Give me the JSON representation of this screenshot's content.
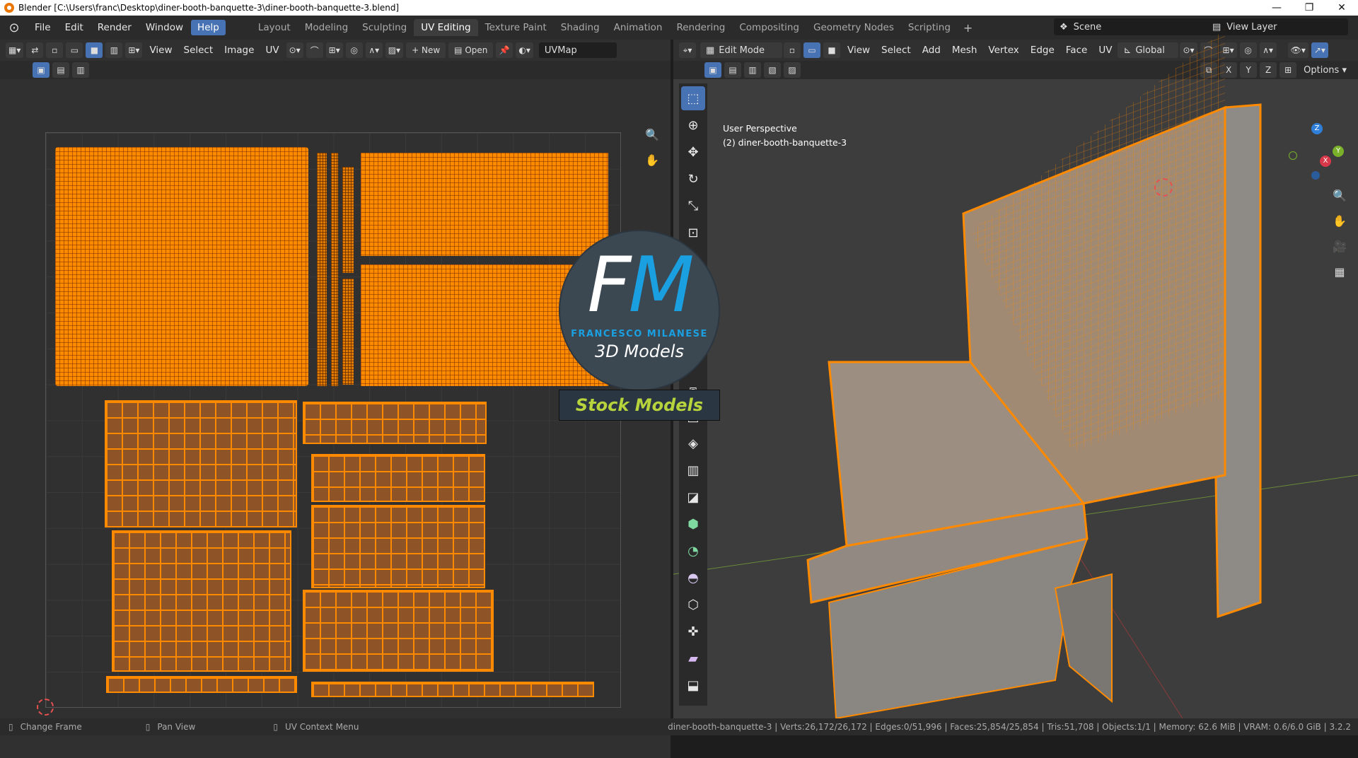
{
  "window": {
    "title": "Blender [C:\\Users\\franc\\Desktop\\diner-booth-banquette-3\\diner-booth-banquette-3.blend]",
    "minimize": "—",
    "maximize": "❐",
    "close": "✕"
  },
  "menu": {
    "items": [
      "File",
      "Edit",
      "Render",
      "Window",
      "Help"
    ],
    "active": "Help"
  },
  "workspaces": {
    "tabs": [
      "Layout",
      "Modeling",
      "Sculpting",
      "UV Editing",
      "Texture Paint",
      "Shading",
      "Animation",
      "Rendering",
      "Compositing",
      "Geometry Nodes",
      "Scripting"
    ],
    "active": "UV Editing",
    "add": "+"
  },
  "scene": {
    "name": "Scene",
    "view_layer": "View Layer"
  },
  "uv_editor": {
    "menus": [
      "View",
      "Select",
      "Image",
      "UV"
    ],
    "new_label": "New",
    "open_label": "Open",
    "uvmap": "UVMap"
  },
  "viewport": {
    "mode": "Edit Mode",
    "menus": [
      "View",
      "Select",
      "Add",
      "Mesh",
      "Vertex",
      "Edge",
      "Face",
      "UV"
    ],
    "orientation": "Global",
    "options": "Options",
    "axes": [
      "X",
      "Y",
      "Z"
    ],
    "overlay_line1": "User Perspective",
    "overlay_line2": "(2) diner-booth-banquette-3",
    "gizmo": {
      "x": "X",
      "y": "Y",
      "z": "Z"
    }
  },
  "watermark": {
    "initial_f": "F",
    "initial_m": "M",
    "name": "FRANCESCO MILANESE",
    "tagline": "3D Models",
    "stock": "Stock Models"
  },
  "status": {
    "left1": "Change Frame",
    "left2": "Pan View",
    "left3": "UV Context Menu",
    "right": "diner-booth-banquette-3 | Verts:26,172/26,172 | Edges:0/51,996 | Faces:25,854/25,854 | Tris:51,708 | Objects:1/1 | Memory: 62.6 MiB | VRAM: 0.6/6.0 GiB | 3.2.2"
  },
  "colors": {
    "accent": "#4772b3",
    "uv_orange": "#ff8a00",
    "mesh_face": "#8e8a86"
  }
}
